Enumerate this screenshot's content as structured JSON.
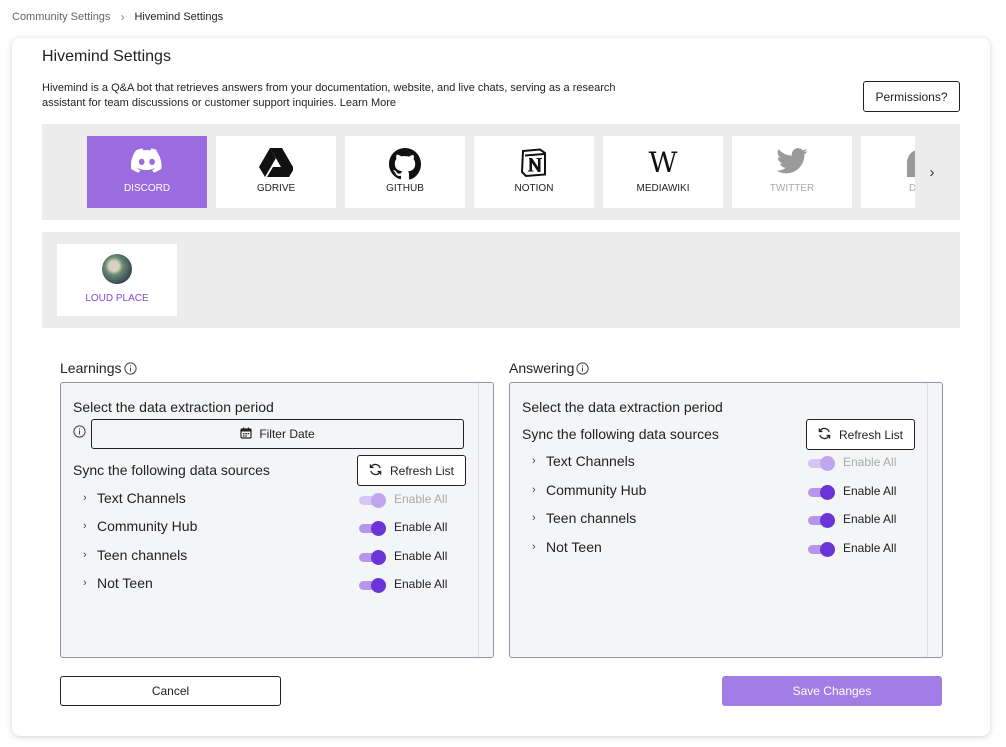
{
  "breadcrumb": {
    "parent": "Community Settings",
    "separator": "›",
    "current": "Hivemind Settings"
  },
  "page": {
    "title": "Hivemind Settings",
    "description": "Hivemind is a Q&A bot that retrieves answers from your documentation, website, and live chats, serving as a research assistant for team discussions or customer support inquiries.",
    "learn_more": "Learn More",
    "permissions_button": "Permissions?"
  },
  "platforms": [
    {
      "label": "DISCORD",
      "icon": "discord-icon",
      "state": "active"
    },
    {
      "label": "GDRIVE",
      "icon": "gdrive-icon",
      "state": "normal"
    },
    {
      "label": "GITHUB",
      "icon": "github-icon",
      "state": "normal"
    },
    {
      "label": "NOTION",
      "icon": "notion-icon",
      "state": "normal"
    },
    {
      "label": "MEDIAWIKI",
      "icon": "mediawiki-icon",
      "state": "normal"
    },
    {
      "label": "TWITTER",
      "icon": "twitter-icon",
      "state": "disabled"
    },
    {
      "label": "DISC",
      "icon": "discourse-icon",
      "state": "disabled"
    }
  ],
  "guild": {
    "label": "LOUD PLACE"
  },
  "learnings": {
    "title": "Learnings",
    "period_label": "Select the data extraction period",
    "filter_button": "Filter Date",
    "sync_label": "Sync the following data sources",
    "refresh_button": "Refresh List",
    "sources": [
      {
        "name": "Text Channels",
        "enable_label": "Enable All",
        "state": "partial"
      },
      {
        "name": "Community Hub",
        "enable_label": "Enable All",
        "state": "on"
      },
      {
        "name": "Teen channels",
        "enable_label": "Enable All",
        "state": "on"
      },
      {
        "name": "Not Teen",
        "enable_label": "Enable All",
        "state": "on"
      }
    ]
  },
  "answering": {
    "title": "Answering",
    "period_label": "Select the data extraction period",
    "sync_label": "Sync the following data sources",
    "refresh_button": "Refresh List",
    "sources": [
      {
        "name": "Text Channels",
        "enable_label": "Enable All",
        "state": "partial"
      },
      {
        "name": "Community Hub",
        "enable_label": "Enable All",
        "state": "on"
      },
      {
        "name": "Teen channels",
        "enable_label": "Enable All",
        "state": "on"
      },
      {
        "name": "Not Teen",
        "enable_label": "Enable All",
        "state": "on"
      }
    ]
  },
  "actions": {
    "cancel": "Cancel",
    "save": "Save Changes"
  },
  "colors": {
    "accent": "#9b6be0",
    "toggle_on": "#6b34d6",
    "save_button": "#a27de6",
    "panel_bg": "#f4f5f7",
    "strip_bg": "#ececec"
  }
}
